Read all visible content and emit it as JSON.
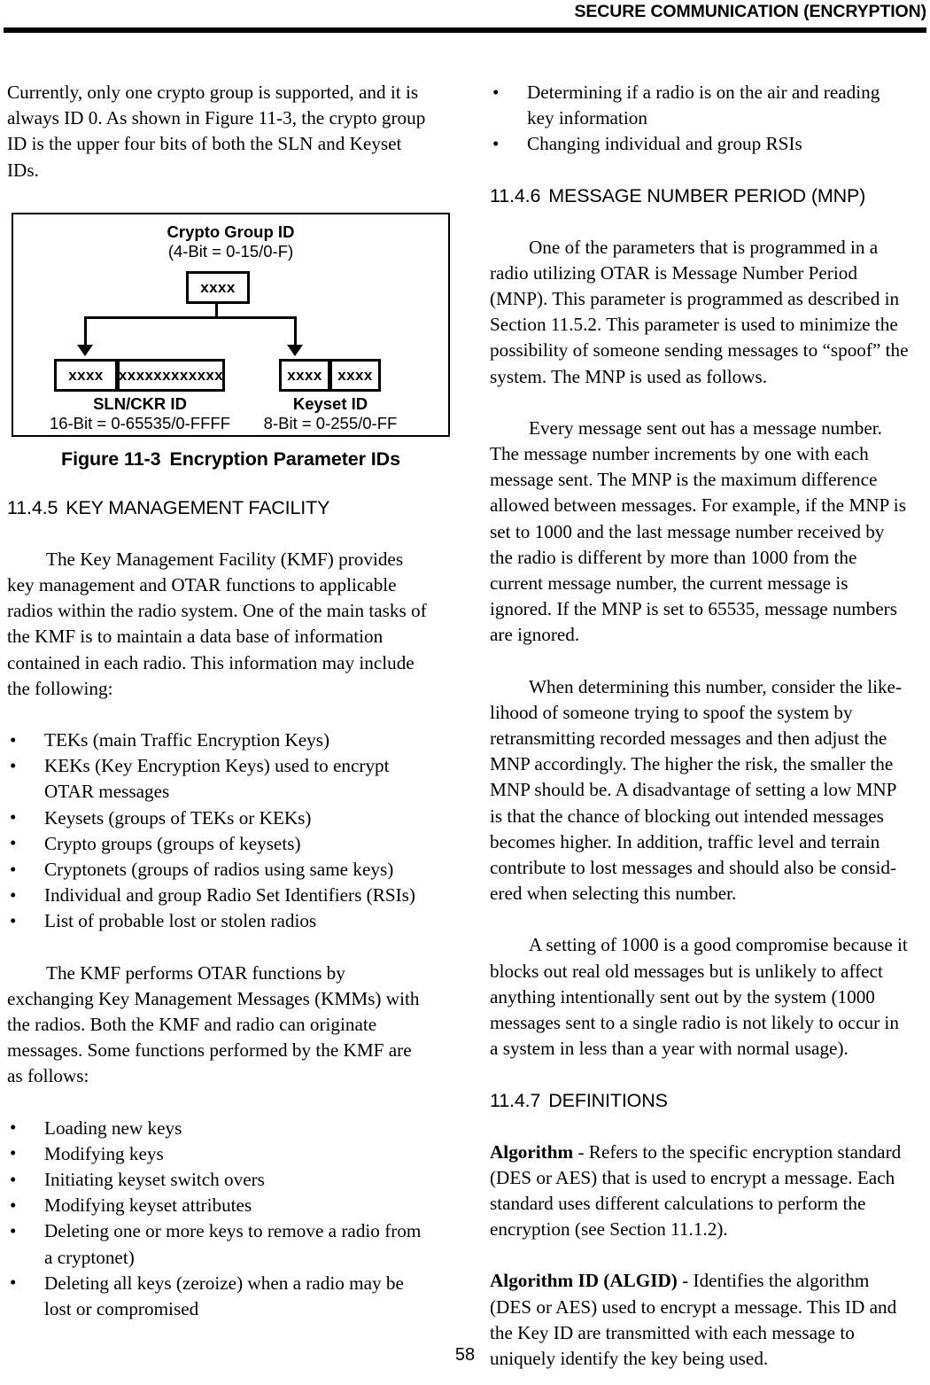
{
  "header": {
    "title": "SECURE COMMUNICATION (ENCRYPTION)"
  },
  "footer": {
    "page_number": "58"
  },
  "left_column": {
    "intro_paragraph": "Currently, only one crypto group is supported, and it is always ID 0. As shown in Figure 11-3, the crypto group ID is the upper four bits of both the SLN and Keyset IDs.",
    "figure": {
      "caption_number": "Figure 11-3",
      "caption_text": "Encryption Parameter IDs",
      "crypto_group_title": "Crypto Group ID",
      "crypto_group_subtitle": "(4-Bit = 0-15/0-F)",
      "crypto_group_cell": "xxxx",
      "sln_cell_high": "xxxx",
      "sln_cell_low": "xxxxxxxxxxxx",
      "sln_label": "SLN/CKR ID",
      "sln_range": "16-Bit = 0-65535/0-FFFF",
      "keyset_cell_high": "xxxx",
      "keyset_cell_low": "xxxx",
      "keyset_label": "Keyset ID",
      "keyset_range": "8-Bit = 0-255/0-FF"
    },
    "section_1145": {
      "number": "11.4.5",
      "title": "KEY MANAGEMENT FACILITY",
      "paragraph": "The Key Management Facility (KMF) provides key management and OTAR functions to applicable radios within the radio system. One of the main tasks of the KMF is to maintain a data base of information contained in each radio. This information may include the following:",
      "bullets": [
        "TEKs (main Traffic Encryption Keys)",
        "KEKs (Key Encryption Keys) used to encrypt OTAR messages",
        "Keysets (groups of TEKs or KEKs)",
        "Crypto groups (groups of keysets)",
        "Cryptonets (groups of radios using same keys)",
        "Individual and group Radio Set Identifiers (RSIs)",
        "List of probable lost or stolen radios"
      ],
      "paragraph_2": "The KMF performs OTAR functions by exchanging Key Management Messages (KMMs) with the radios. Both the KMF and radio can originate messages. Some functions performed by the KMF are as follows:",
      "bullets_2": [
        "Loading new keys",
        "Modifying keys",
        "Initiating keyset switch overs",
        "Modifying keyset attributes",
        "Deleting one or more keys to remove a radio from a cryptonet)",
        "Deleting all keys (zeroize) when a radio may be lost or compromised"
      ]
    }
  },
  "right_column": {
    "continued_bullets": [
      "Determining if a radio is on the air and reading key information",
      "Changing individual and group RSIs"
    ],
    "section_1146": {
      "number": "11.4.6",
      "title": "MESSAGE NUMBER PERIOD (MNP)",
      "paragraph_1": "One of the parameters that is programmed in a radio utilizing OTAR is Message Number Period (MNP). This parameter is programmed as described in Section 11.5.2. This parameter is used to minimize the possibility of someone sending messages to “spoof” the system. The MNP is used as follows.",
      "paragraph_2": "Every message sent out has a message number. The message number increments by one with each message sent. The MNP is the maximum difference allowed between messages. For example, if the MNP is set to 1000 and the last message number received by the radio is different by more than 1000 from the current message number, the current message is ignored. If the MNP is set to 65535, message numbers are ignored.",
      "paragraph_3": "When determining this number, consider the like-lihood of someone trying to spoof the system by retransmitting recorded messages and then adjust the MNP accordingly. The higher the risk, the smaller the MNP should be. A disadvantage of setting a low MNP is that the chance of blocking out intended messages becomes higher. In addition, traffic level and terrain contribute to lost messages and should also be consid-ered when selecting this number.",
      "paragraph_4": "A setting of 1000 is a good compromise because it blocks out real old messages but is unlikely to affect anything intentionally sent out by the system (1000 messages sent to a single radio is not likely to occur in a system in less than a year with normal usage)."
    },
    "section_1147": {
      "number": "11.4.7",
      "title": "DEFINITIONS",
      "definitions": [
        {
          "term": "Algorithm",
          "body": " - Refers to the specific encryption standard (DES or AES) that is used to encrypt a message. Each standard uses different calculations to perform the encryption (see Section 11.1.2)."
        },
        {
          "term": "Algorithm ID (ALGID)",
          "body": " - Identifies the algorithm (DES or AES) used to encrypt a message. This ID and the Key ID are transmitted with each message to uniquely identify the key being used."
        }
      ]
    }
  }
}
